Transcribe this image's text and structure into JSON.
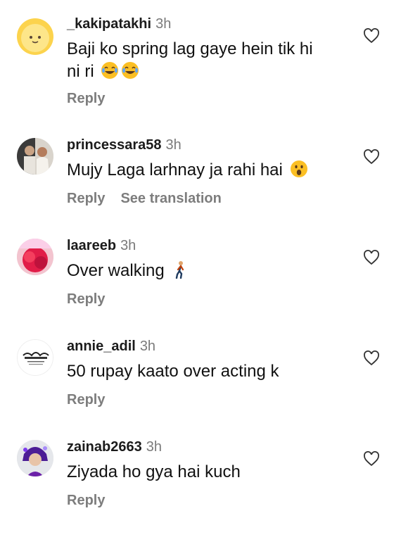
{
  "comments": [
    {
      "username": "_kakipatakhi",
      "time": "3h",
      "text_line1": "Baji ko spring lag gaye hein tik hi",
      "text_line2": "ni ri",
      "reply": "Reply"
    },
    {
      "username": "princessara58",
      "time": "3h",
      "text": "Mujy Laga larhnay ja rahi hai",
      "reply": "Reply",
      "translate": "See translation"
    },
    {
      "username": "laareeb",
      "time": "3h",
      "text": "Over walking",
      "reply": "Reply"
    },
    {
      "username": "annie_adil",
      "time": "3h",
      "text": "50 rupay kaato over acting k",
      "reply": "Reply"
    },
    {
      "username": "zainab2663",
      "time": "3h",
      "text": "Ziyada ho gya hai kuch",
      "reply": "Reply"
    }
  ],
  "icons": {
    "like": "heart-outline-icon",
    "emoji_laugh": "tears-of-joy-emoji",
    "emoji_surprised": "open-mouth-emoji",
    "emoji_walk": "person-walking-emoji"
  },
  "colors": {
    "username": "#1b1b1b",
    "secondary": "#7a7a7a",
    "text": "#111111",
    "background": "#ffffff"
  }
}
